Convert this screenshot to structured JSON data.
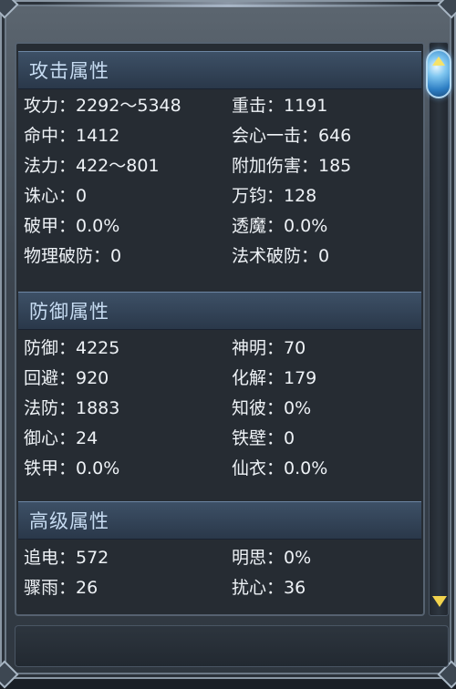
{
  "sections": [
    {
      "title": "攻击属性",
      "rows": [
        {
          "left": "攻力：2292～5348",
          "right": "重击：1191"
        },
        {
          "left": "命中：1412",
          "right": "会心一击：646"
        },
        {
          "left": "法力：422～801",
          "right": "附加伤害：185"
        },
        {
          "left": "诛心：0",
          "right": "万钧：128"
        },
        {
          "left": "破甲：0.0%",
          "right": "透魔：0.0%"
        },
        {
          "left": "物理破防：0",
          "right": "法术破防：0"
        }
      ]
    },
    {
      "title": "防御属性",
      "rows": [
        {
          "left": "防御：4225",
          "right": "神明：70"
        },
        {
          "left": "回避：920",
          "right": "化解：179"
        },
        {
          "left": "法防：1883",
          "right": "知彼：0%"
        },
        {
          "left": "御心：24",
          "right": "铁壁：0"
        },
        {
          "left": "铁甲：0.0%",
          "right": "仙衣：0.0%"
        }
      ]
    },
    {
      "title": "高级属性",
      "rows": [
        {
          "left": "追电：572",
          "right": "明思：0%"
        },
        {
          "left": "骤雨：26",
          "right": "扰心：36"
        }
      ]
    }
  ],
  "colors": {
    "header_text": "#c7dcf2",
    "value_text": "#eef2f6",
    "scroll_accent": "#f2d34d"
  },
  "icons": {
    "scroll_up": "scroll-up-arrow-icon",
    "scroll_down": "scroll-down-arrow-icon"
  }
}
